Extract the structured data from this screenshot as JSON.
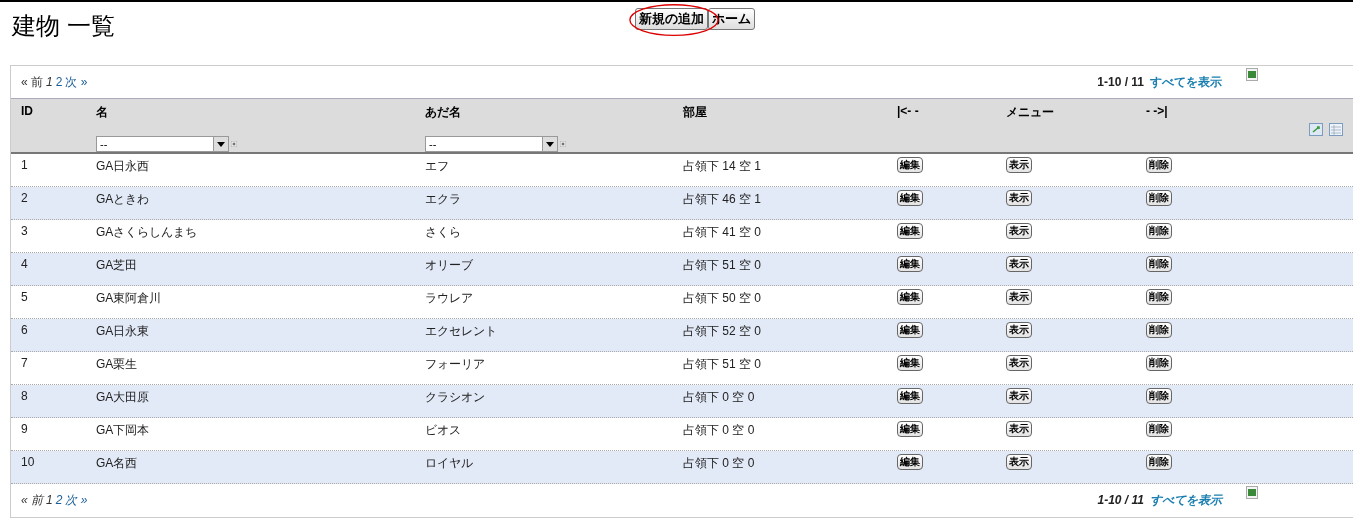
{
  "title": "建物 一覧",
  "header_buttons": [
    {
      "label": "新規の追加",
      "circled": true
    },
    {
      "label": "ホーム",
      "circled": false
    }
  ],
  "pager_top": {
    "prev": "« 前",
    "pages": [
      {
        "label": "1",
        "selected": true
      },
      {
        "label": "2",
        "selected": false
      }
    ],
    "next": "次 »",
    "range": "1-10 / 11",
    "show_all": "すべてを表示"
  },
  "columns": [
    {
      "label": "ID"
    },
    {
      "label": "名",
      "filter": "--"
    },
    {
      "label": "あだ名",
      "filter": "--"
    },
    {
      "label": "部屋"
    },
    {
      "label": "|<- -"
    },
    {
      "label": "メニュー"
    },
    {
      "label": "- ->|"
    }
  ],
  "rows": [
    {
      "id": "1",
      "name": "GA日永西",
      "nickname": "エフ",
      "rooms": "占領下 14 空 1",
      "actions": [
        "編集",
        "表示",
        "削除"
      ]
    },
    {
      "id": "2",
      "name": "GAときわ",
      "nickname": "エクラ",
      "rooms": "占領下 46 空 1",
      "actions": [
        "編集",
        "表示",
        "削除"
      ]
    },
    {
      "id": "3",
      "name": "GAさくらしんまち",
      "nickname": "さくら",
      "rooms": "占領下 41 空 0",
      "actions": [
        "編集",
        "表示",
        "削除"
      ]
    },
    {
      "id": "4",
      "name": "GA芝田",
      "nickname": "オリーブ",
      "rooms": "占領下 51 空 0",
      "actions": [
        "編集",
        "表示",
        "削除"
      ]
    },
    {
      "id": "5",
      "name": "GA東阿倉川",
      "nickname": "ラウレア",
      "rooms": "占領下 50 空 0",
      "actions": [
        "編集",
        "表示",
        "削除"
      ]
    },
    {
      "id": "6",
      "name": "GA日永東",
      "nickname": "エクセレント",
      "rooms": "占領下 52 空 0",
      "actions": [
        "編集",
        "表示",
        "削除"
      ]
    },
    {
      "id": "7",
      "name": "GA栗生",
      "nickname": "フォーリア",
      "rooms": "占領下 51 空 0",
      "actions": [
        "編集",
        "表示",
        "削除"
      ]
    },
    {
      "id": "8",
      "name": "GA大田原",
      "nickname": "クラシオン",
      "rooms": "占領下 0 空 0",
      "actions": [
        "編集",
        "表示",
        "削除"
      ]
    },
    {
      "id": "9",
      "name": "GA下岡本",
      "nickname": "ビオス",
      "rooms": "占領下 0 空 0",
      "actions": [
        "編集",
        "表示",
        "削除"
      ]
    },
    {
      "id": "10",
      "name": "GA名西",
      "nickname": "ロイヤル",
      "rooms": "占領下 0 空 0",
      "actions": [
        "編集",
        "表示",
        "削除"
      ]
    }
  ],
  "pager_bottom": {
    "prev": "« 前",
    "pages": [
      {
        "label": "1",
        "selected": true
      },
      {
        "label": "2",
        "selected": false
      }
    ],
    "next": "次 »",
    "range": "1-10 / 11",
    "show_all": "すべてを表示"
  }
}
